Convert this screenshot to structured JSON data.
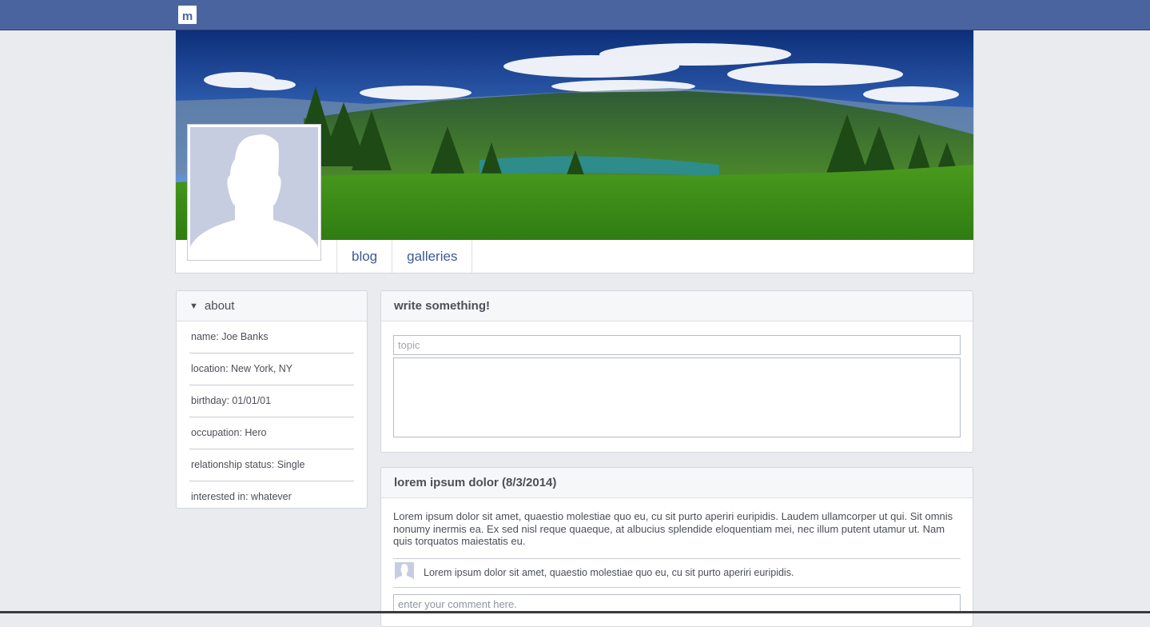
{
  "colors": {
    "topbar": "#4a64a0",
    "link": "#3b5998",
    "page_bg": "#e9ebee",
    "avatar_placeholder": "#c6cde0"
  },
  "header": {
    "logo_letter": "m"
  },
  "profile": {
    "cover_image": "landscape-cover-photo",
    "avatar_icon": "default-avatar-silhouette-icon",
    "nav": [
      {
        "label": "blog"
      },
      {
        "label": "galleries"
      }
    ]
  },
  "about": {
    "title": "about",
    "caret_icon": "triangle-down-icon",
    "items": [
      {
        "text": "name: Joe Banks"
      },
      {
        "text": "location: New York, NY"
      },
      {
        "text": "birthday: 01/01/01"
      },
      {
        "text": "occupation: Hero"
      },
      {
        "text": "relationship status: Single"
      },
      {
        "text": "interested in: whatever"
      }
    ]
  },
  "compose": {
    "title": "write something!",
    "topic_placeholder": "topic",
    "body_value": ""
  },
  "post": {
    "title": "lorem ipsum dolor (8/3/2014)",
    "body": "Lorem ipsum dolor sit amet, quaestio molestiae quo eu, cu sit purto aperiri euripidis. Laudem ullamcorper ut qui. Sit omnis nonumy inermis ea. Ex sed nisl reque quaeque, at albucius splendide eloquentiam mei, nec illum putent utamur ut. Nam quis torquatos maiestatis eu.",
    "comments": [
      {
        "text": "Lorem ipsum dolor sit amet, quaestio molestiae quo eu, cu sit purto aperiri euripidis."
      }
    ],
    "comment_placeholder": "enter your comment here."
  }
}
